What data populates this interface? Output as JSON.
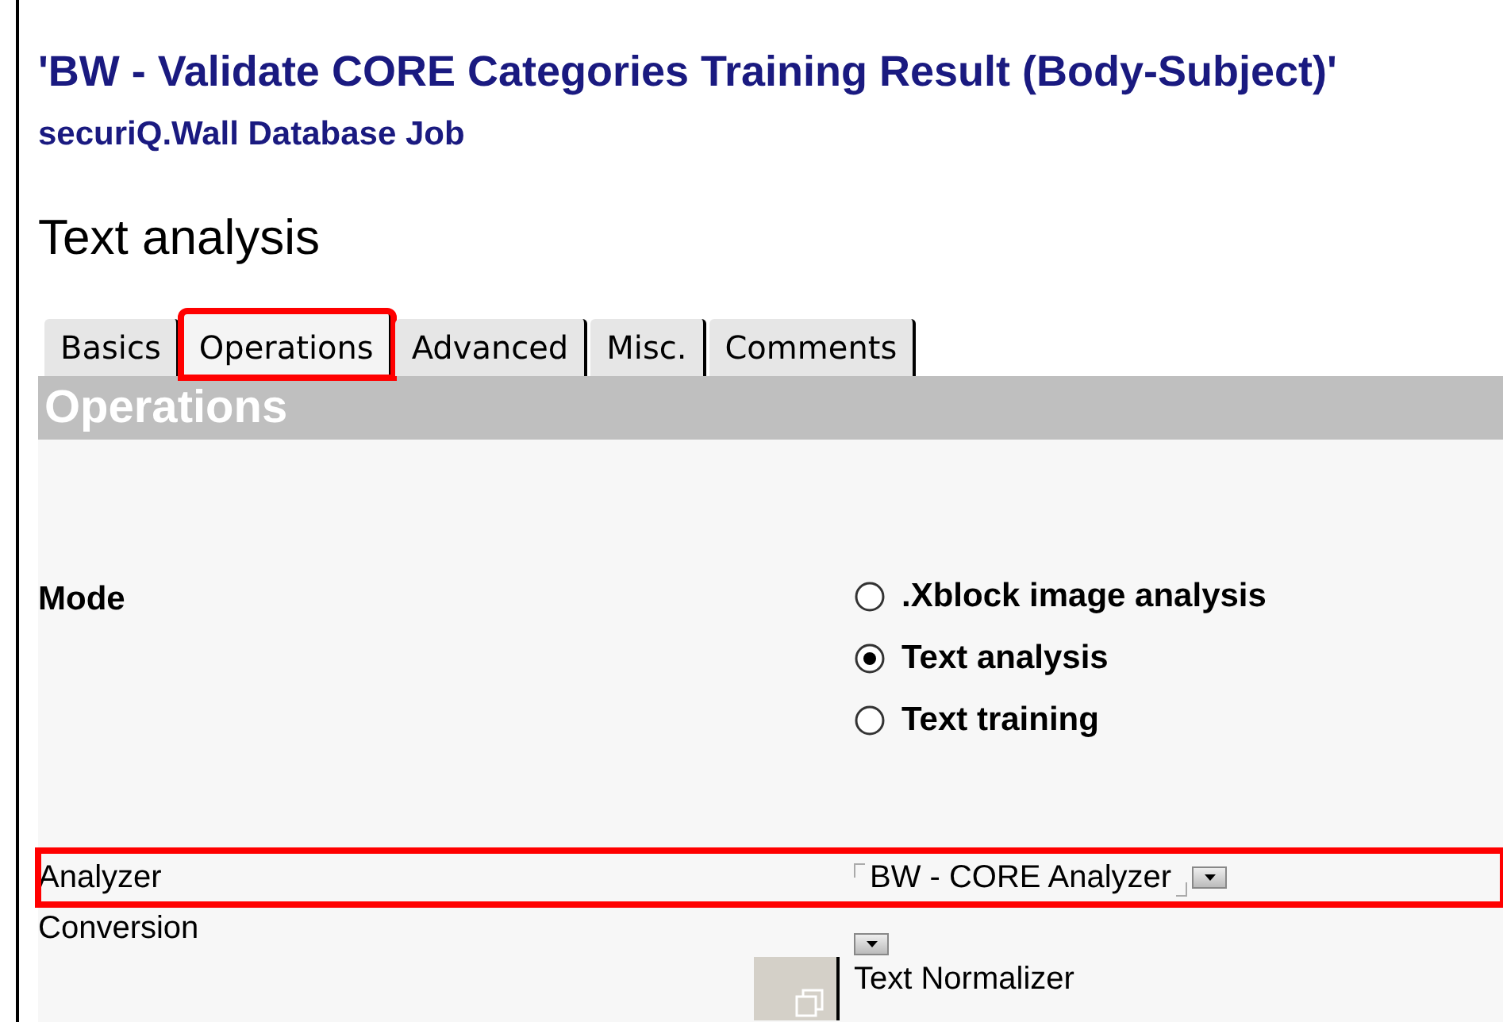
{
  "header": {
    "title": "'BW - Validate CORE Categories Training Result (Body-Subject)'",
    "subtitle": "securiQ.Wall Database Job",
    "heading": "Text analysis"
  },
  "tabs": [
    {
      "label": "Basics",
      "selected": false,
      "highlighted": false
    },
    {
      "label": "Operations",
      "selected": true,
      "highlighted": true
    },
    {
      "label": "Advanced",
      "selected": false,
      "highlighted": false
    },
    {
      "label": "Misc.",
      "selected": false,
      "highlighted": false
    },
    {
      "label": "Comments",
      "selected": false,
      "highlighted": false
    }
  ],
  "section": {
    "title": "Operations"
  },
  "mode": {
    "label": "Mode",
    "options": [
      {
        "label": ".Xblock image analysis",
        "selected": false
      },
      {
        "label": "Text analysis",
        "selected": true
      },
      {
        "label": "Text training",
        "selected": false
      }
    ]
  },
  "analyzer": {
    "label": "Analyzer",
    "value": "BW - CORE Analyzer",
    "highlighted": true
  },
  "conversion": {
    "label": "Conversion",
    "value": "Text Normalizer"
  }
}
